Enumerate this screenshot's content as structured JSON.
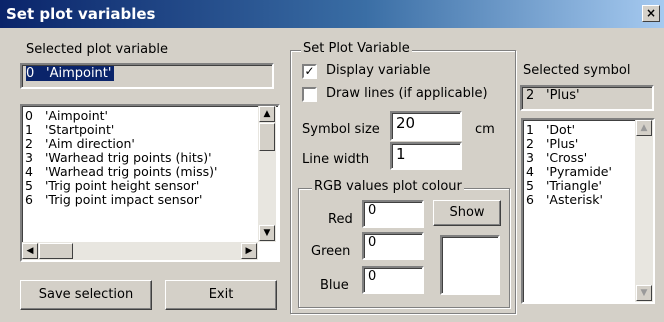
{
  "window": {
    "title": "Set plot variables",
    "close_glyph": "×"
  },
  "left": {
    "heading": "Selected plot variable",
    "selected": {
      "num": "0",
      "label": "'Aimpoint'"
    },
    "list": [
      {
        "num": "0",
        "label": "'Aimpoint'"
      },
      {
        "num": "1",
        "label": "'Startpoint'"
      },
      {
        "num": "2",
        "label": "'Aim direction'"
      },
      {
        "num": "3",
        "label": "'Warhead trig points (hits)'"
      },
      {
        "num": "4",
        "label": "'Warhead trig points (miss)'"
      },
      {
        "num": "5",
        "label": "'Trig point height sensor'"
      },
      {
        "num": "6",
        "label": "'Trig point impact sensor'"
      }
    ],
    "buttons": {
      "save": "Save selection",
      "exit": "Exit"
    }
  },
  "set_plot": {
    "group_label": "Set Plot Variable",
    "display_variable": {
      "label": "Display variable",
      "checked": true,
      "mark": "✓"
    },
    "draw_lines": {
      "label": "Draw lines (if applicable)",
      "checked": false
    },
    "symbol_size": {
      "label": "Symbol size",
      "value": "20",
      "unit": "cm"
    },
    "line_width": {
      "label": "Line width",
      "value": "1"
    },
    "rgb": {
      "group_label": "RGB values plot colour",
      "red": {
        "label": "Red",
        "value": "0"
      },
      "green": {
        "label": "Green",
        "value": "0"
      },
      "blue": {
        "label": "Blue",
        "value": "0"
      },
      "show_button": "Show"
    }
  },
  "symbol": {
    "heading": "Selected symbol",
    "selected": {
      "num": "2",
      "label": "'Plus'"
    },
    "list": [
      {
        "num": "1",
        "label": "'Dot'"
      },
      {
        "num": "2",
        "label": "'Plus'"
      },
      {
        "num": "3",
        "label": "'Cross'"
      },
      {
        "num": "4",
        "label": "'Pyramide'"
      },
      {
        "num": "5",
        "label": "'Triangle'"
      },
      {
        "num": "6",
        "label": "'Asterisk'"
      }
    ]
  },
  "colors": {
    "title_start": "#0a246a",
    "title_end": "#a6caf0",
    "face": "#d4d0c8",
    "selection": "#0a246a"
  }
}
